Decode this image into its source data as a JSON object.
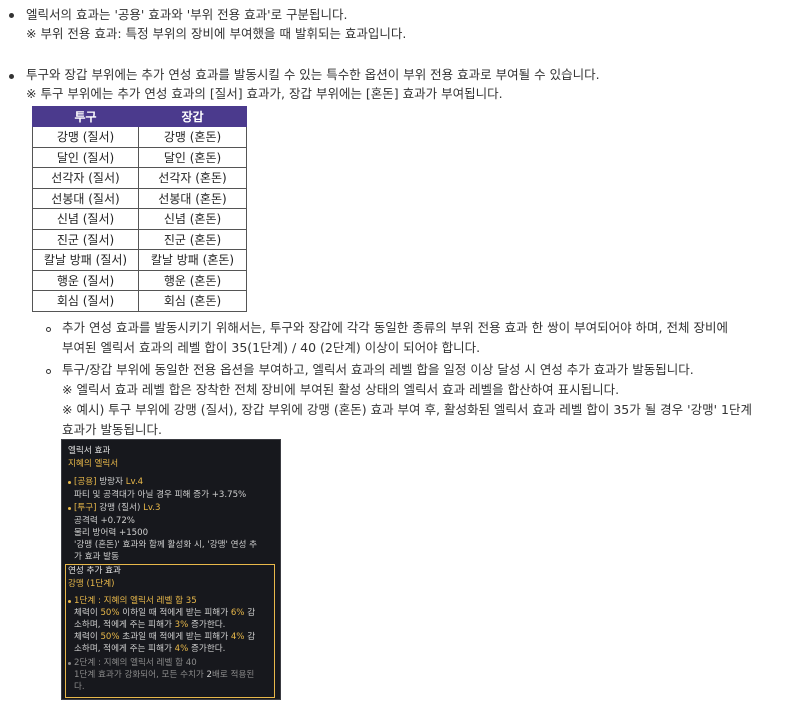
{
  "section1": {
    "line1": "엘릭서의 효과는 '공용' 효과와 '부위 전용 효과'로 구분됩니다.",
    "line2": "※ 부위 전용 효과: 특정 부위의 장비에 부여했을 때 발휘되는 효과입니다."
  },
  "section2": {
    "line1": "투구와 장갑 부위에는 추가 연성 효과를 발동시킬 수 있는 특수한 옵션이 부위 전용 효과로 부여될 수 있습니다.",
    "line2": "※ 투구 부위에는 추가 연성 효과의 [질서] 효과가, 장갑 부위에는 [혼돈] 효과가 부여됩니다."
  },
  "table": {
    "headers": [
      "투구",
      "장갑"
    ],
    "rows": [
      [
        "강맹 (질서)",
        "강맹 (혼돈)"
      ],
      [
        "달인 (질서)",
        "달인 (혼돈)"
      ],
      [
        "선각자 (질서)",
        "선각자 (혼돈)"
      ],
      [
        "선봉대 (질서)",
        "선봉대 (혼돈)"
      ],
      [
        "신념 (질서)",
        "신념 (혼돈)"
      ],
      [
        "진군 (질서)",
        "진군 (혼돈)"
      ],
      [
        "칼날 방패 (질서)",
        "칼날 방패 (혼돈)"
      ],
      [
        "행운 (질서)",
        "행운 (혼돈)"
      ],
      [
        "회심 (질서)",
        "회심 (혼돈)"
      ]
    ],
    "header_color": "#4b3a8d"
  },
  "sub1": {
    "line1": "추가 연성 효과를 발동시키기 위해서는, 투구와 장갑에 각각 동일한 종류의 부위 전용 효과 한 쌍이 부여되어야 하며, 전체 장비에",
    "line2": "부여된 엘릭서 효과의 레벨 합이 35(1단계) / 40 (2단계) 이상이 되어야 합니다."
  },
  "sub2": {
    "line1": "투구/장갑 부위에 동일한 전용 옵션을 부여하고, 엘릭서 효과의 레벨 합을 일정 이상 달성 시 연성 추가 효과가 발동됩니다.",
    "line2": "※ 엘릭서 효과 레벨 합은 장착한 전체 장비에 부여된 활성 상태의 엘릭서 효과 레벨을 합산하여 표시됩니다.",
    "line3": "※ 예시) 투구 부위에 강맹 (질서), 장갑 부위에 강맹 (혼돈) 효과 부여 후, 활성화된 엘릭서 효과 레벨 합이 35가 될 경우 '강맹' 1단계",
    "line4": "효과가 발동됩니다."
  },
  "tooltip": {
    "header": "엘릭서 효과",
    "subheader": "지혜의 엘릭서",
    "common_tag": "[공용]",
    "common_name": "방랑자",
    "common_level": "Lv.4",
    "common_desc": "파티 및 공격대가 아닐 경우 피해 증가 +3.75%",
    "helm_tag": "[투구]",
    "helm_name": "강맹 (질서)",
    "helm_level": "Lv.3",
    "helm_stat1": "공격력 +0.72%",
    "helm_stat2": "물리 방어력 +1500",
    "helm_note1": "'강맹 (혼돈)' 효과와 함께 활성화 시, '강맹' 연성 추",
    "helm_note2": "가 효과 발동",
    "extra_title": "연성 추가 효과",
    "extra_name": "강맹 (1단계)",
    "stage1_title": "1단계 : 지혜의 엘릭서 레벨 합 35",
    "stage1_l1a": "체력이 ",
    "stage1_l1b": "50%",
    "stage1_l1c": " 이하일 때 적에게 받는 피해가 ",
    "stage1_l1d": "6%",
    "stage1_l1e": " 감",
    "stage1_l2a": "소하며, 적에게 주는 피해가 ",
    "stage1_l2b": "3%",
    "stage1_l2c": " 증가한다.",
    "stage1_l3a": "체력이 ",
    "stage1_l3b": "50%",
    "stage1_l3c": " 초과일 때 적에게 받는 피해가 ",
    "stage1_l3d": "4%",
    "stage1_l3e": " 감",
    "stage1_l4a": "소하며, 적에게 주는 피해가 ",
    "stage1_l4b": "4%",
    "stage1_l4c": " 증가한다.",
    "stage2_title": "2단계 : 지혜의 엘릭서 레벨 합 40",
    "stage2_l1a": "1단계 효과가 강화되어, 모든 수치가 ",
    "stage2_l1b": "2",
    "stage2_l1c": "배로 적용된",
    "stage2_l2": "다."
  }
}
